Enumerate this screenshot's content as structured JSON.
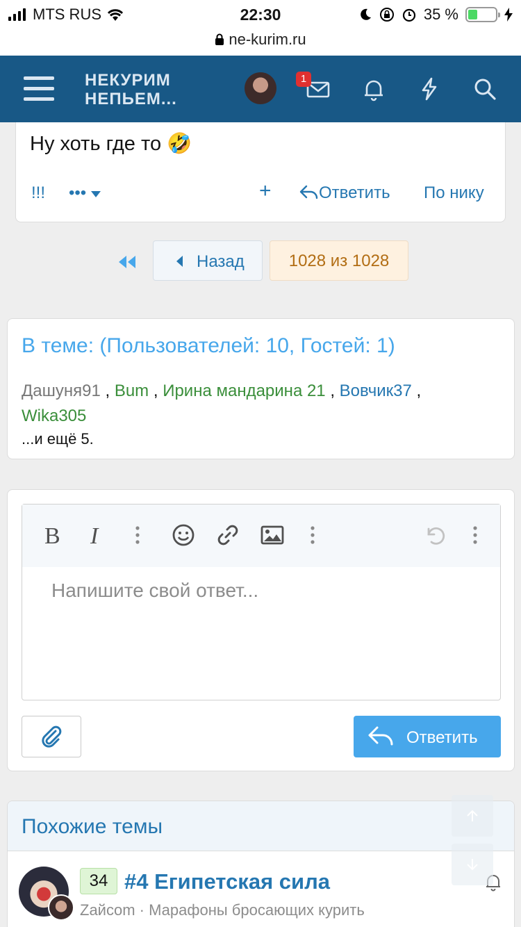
{
  "status": {
    "carrier": "MTS RUS",
    "time": "22:30",
    "battery": "35 %"
  },
  "browser": {
    "url": "ne-kurim.ru"
  },
  "header": {
    "logo_line1": "НЕКУРИМ",
    "logo_line2": "НЕПЬЕМ...",
    "inbox_badge": "1"
  },
  "post": {
    "message": "Ну хоть где то 🤣",
    "action_exclaim": "!!!",
    "action_more": "•••",
    "action_plus": "+",
    "action_reply": "Ответить",
    "action_mention": "По нику"
  },
  "pager": {
    "back_label": "Назад",
    "current": "1028 из 1028"
  },
  "online": {
    "title": "В теме: (Пользователей: 10, Гостей: 1)",
    "users": [
      "Дашуня91",
      "Bum",
      "Ирина мандарина 21",
      "Вовчик37",
      "Wika305"
    ],
    "more": "...и ещё 5."
  },
  "reply": {
    "placeholder": "Напишите свой ответ...",
    "submit_label": "Ответить"
  },
  "similar": {
    "title": "Похожие темы",
    "thread": {
      "replies": "34",
      "title": "#4 Египетская сила",
      "author": "Zaйcom",
      "forum": "Марафоны бросающих курить"
    }
  },
  "colors": {
    "header_bg": "#185886",
    "accent": "#47a7eb",
    "link": "#2577b1"
  }
}
